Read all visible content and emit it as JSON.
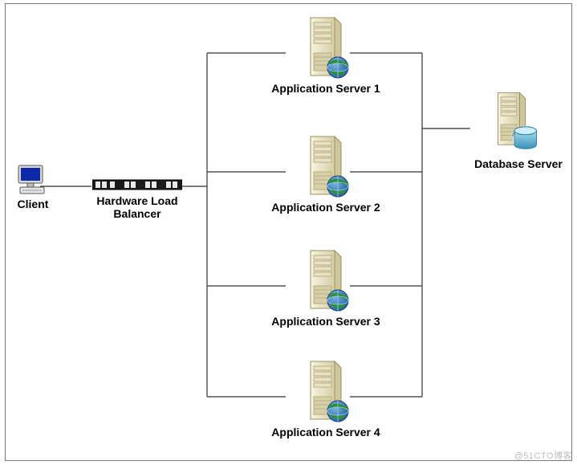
{
  "diagram": {
    "client": {
      "label": "Client"
    },
    "balancer": {
      "label_line1": "Hardware Load",
      "label_line2": "Balancer"
    },
    "app_servers": [
      {
        "label": "Application Server 1"
      },
      {
        "label": "Application Server 2"
      },
      {
        "label": "Application Server 3"
      },
      {
        "label": "Application Server 4"
      }
    ],
    "database": {
      "label": "Database Server"
    }
  },
  "watermark": "@51CTO博客",
  "colors": {
    "server_body": "#f1ecd6",
    "server_shade": "#cfc69e",
    "server_edge": "#9b925f",
    "globe_blue": "#2f6fb3",
    "globe_land": "#2e8f3a",
    "db_cyl": "#7abfe0",
    "db_cyl_dark": "#3a8fb8",
    "monitor_blue": "#0a2aa8",
    "rack_black": "#1a1a1a",
    "wire": "#333333",
    "frame": "#7a7a7a"
  }
}
